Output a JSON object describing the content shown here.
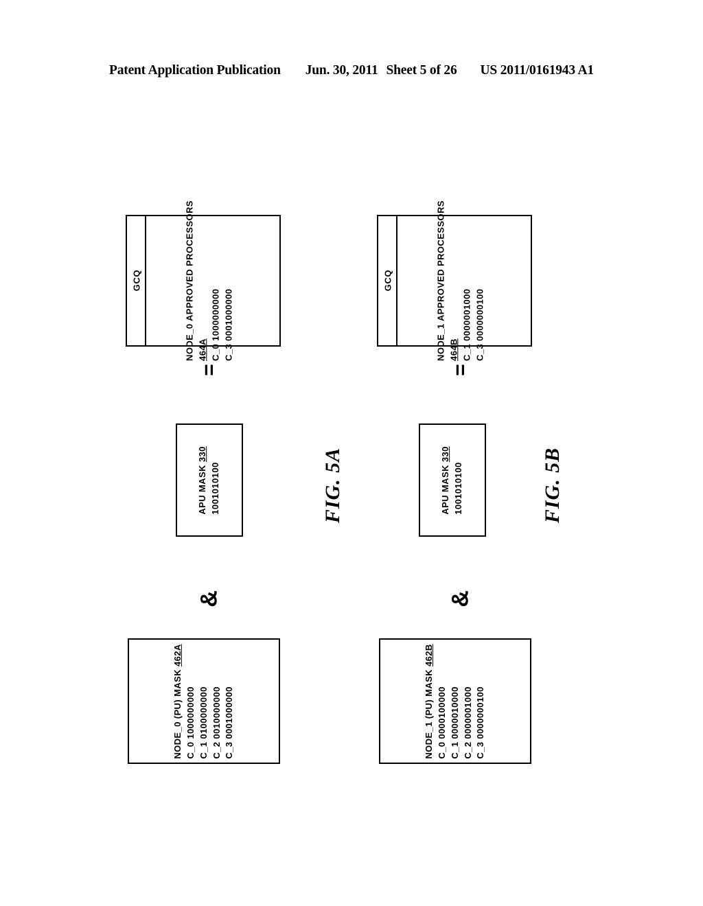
{
  "header": {
    "publication": "Patent Application Publication",
    "date": "Jun. 30, 2011",
    "sheet": "Sheet 5 of 26",
    "number": "US 2011/0161943 A1"
  },
  "figures": [
    {
      "caption": "FIG. 5A",
      "operand_box": {
        "title": "NODE_0 (PU) MASK",
        "ref": "462A",
        "rows": [
          {
            "label": "C_0",
            "value": "1000000000"
          },
          {
            "label": "C_1",
            "value": "0100000000"
          },
          {
            "label": "C_2",
            "value": "0010000000"
          },
          {
            "label": "C_3",
            "value": "0001000000"
          }
        ]
      },
      "operator_1": "&",
      "mask_box": {
        "title": "APU MASK",
        "ref": "330",
        "value": "1001010100"
      },
      "operator_2": "=",
      "result_box": {
        "header_label": "GCQ",
        "title": "NODE_0 APPROVED PROCESSORS",
        "ref": "464A",
        "rows": [
          {
            "label": "C_0",
            "value": "1000000000"
          },
          {
            "label": "C_3",
            "value": "0001000000"
          }
        ]
      }
    },
    {
      "caption": "FIG. 5B",
      "operand_box": {
        "title": "NODE_1 (PU) MASK",
        "ref": "462B",
        "rows": [
          {
            "label": "C_0",
            "value": "0000100000"
          },
          {
            "label": "C_1",
            "value": "0000010000"
          },
          {
            "label": "C_2",
            "value": "0000001000"
          },
          {
            "label": "C_3",
            "value": "0000000100"
          }
        ]
      },
      "operator_1": "&",
      "mask_box": {
        "title": "APU MASK",
        "ref": "330",
        "value": "1001010100"
      },
      "operator_2": "=",
      "result_box": {
        "header_label": "GCQ",
        "title": "NODE_1 APPROVED PROCESSORS",
        "ref": "464B",
        "rows": [
          {
            "label": "C_1",
            "value": "0000001000"
          },
          {
            "label": "C_3",
            "value": "0000000100"
          }
        ]
      }
    }
  ]
}
